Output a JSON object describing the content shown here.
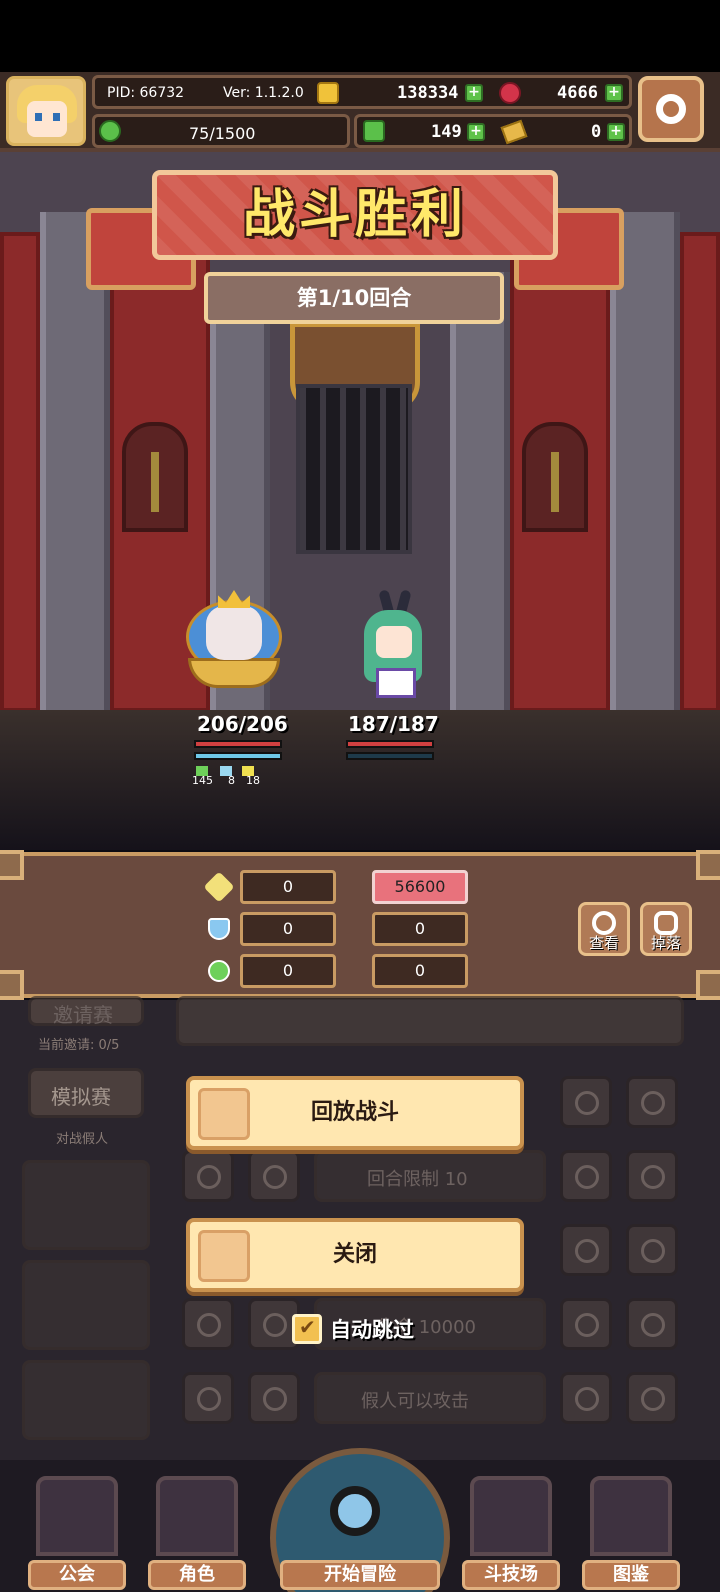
{
  "hud": {
    "pid": "PID: 66732",
    "version": "Ver: 1.1.2.0",
    "gold": "138334",
    "gems": "4666",
    "stamina": "75/1500",
    "clover": "149",
    "tickets": "0",
    "icons": [
      "coin-icon",
      "gem-icon",
      "clover-icon",
      "ticket-icon",
      "settings-icon"
    ]
  },
  "battle": {
    "title": "战斗胜利",
    "round": "第1/10回合",
    "player": {
      "hp": "206/206",
      "buffs": [
        "145",
        "8",
        "18"
      ]
    },
    "enemy": {
      "hp": "187/187"
    }
  },
  "stats": {
    "rows": [
      {
        "icon": "attack-icon",
        "left": "0",
        "right": "56600"
      },
      {
        "icon": "shield-icon",
        "left": "0",
        "right": "0"
      },
      {
        "icon": "heal-icon",
        "left": "0",
        "right": "0"
      }
    ],
    "view_label": "查看",
    "drop_label": "掉落"
  },
  "background_menu": {
    "invite_label": "邀请赛",
    "invite_status": "当前邀请: 0/5",
    "sim_label": "模拟赛",
    "sim_sub": "对战假人",
    "round_limit": "回合限制 10",
    "life": "生命 10000",
    "dummy_attack": "假人可以攻击"
  },
  "actions": {
    "replay": "回放战斗",
    "close": "关闭",
    "auto_skip": "自动跳过"
  },
  "nav": {
    "guild": "公会",
    "role": "角色",
    "adventure": "开始冒险",
    "arena": "斗技场",
    "codex": "图鉴"
  },
  "colors": {
    "accent_red": "#d0564a",
    "title_yellow": "#ffe86a",
    "highlight_pink": "#e8727c",
    "hp_red": "#d04040",
    "mp_blue": "#6ec8e8"
  }
}
